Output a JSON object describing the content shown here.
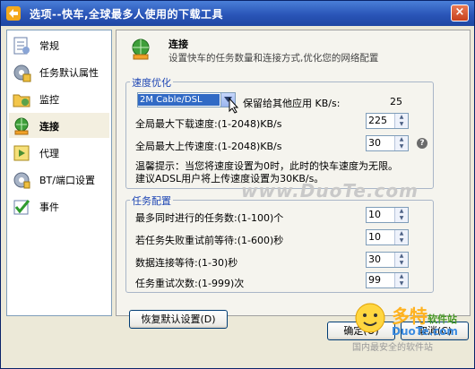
{
  "window": {
    "title": "选项--快车,全球最多人使用的下载工具",
    "close_label": "×"
  },
  "sidebar": {
    "items": [
      {
        "label": "常规",
        "icon": "settings-sheet-icon"
      },
      {
        "label": "任务默认属性",
        "icon": "gear-task-icon"
      },
      {
        "label": "监控",
        "icon": "monitor-folder-icon"
      },
      {
        "label": "连接",
        "icon": "connection-globe-icon",
        "active": true
      },
      {
        "label": "代理",
        "icon": "proxy-icon"
      },
      {
        "label": "BT/端口设置",
        "icon": "bt-port-icon"
      },
      {
        "label": "事件",
        "icon": "event-check-icon"
      }
    ]
  },
  "panel": {
    "title": "连接",
    "subtitle": "设置快车的任务数量和连接方式,优化您的网络配置"
  },
  "speed": {
    "legend": "速度优化",
    "line_type": "2M Cable/DSL",
    "reserve_label": "保留给其他应用 KB/s:",
    "reserve_value": "25",
    "max_download_label": "全局最大下载速度:(1-2048)KB/s",
    "max_download_value": "225",
    "max_upload_label": "全局最大上传速度:(1-2048)KB/s",
    "max_upload_value": "30",
    "help_label": "?",
    "tip_line1": "温馨提示：当您将速度设置为0时，此时的快车速度为无限。",
    "tip_line2": "建议ADSL用户将上传速度设置为30KB/s。"
  },
  "tasks": {
    "legend": "任务配置",
    "max_tasks_label": "最多同时进行的任务数:(1-100)个",
    "max_tasks_value": "10",
    "retry_wait_label": "若任务失败重试前等待:(1-600)秒",
    "retry_wait_value": "10",
    "conn_wait_label": "数据连接等待:(1-30)秒",
    "conn_wait_value": "30",
    "retry_count_label": "任务重试次数:(1-999)次",
    "retry_count_value": "99"
  },
  "buttons": {
    "restore": "恢复默认设置(D)",
    "ok": "确定(O)",
    "cancel": "取消(C)"
  },
  "overlay": {
    "watermark": "www.DuoTe.com",
    "logo_main": "多特",
    "logo_small": "软件站",
    "logo_domain": "DuoTe.com",
    "logo_tagline": "国内最安全的软件站"
  },
  "colors": {
    "title_bar": "#2a55b8",
    "legend_text": "#1e46b4",
    "selection": "#316ac5"
  }
}
